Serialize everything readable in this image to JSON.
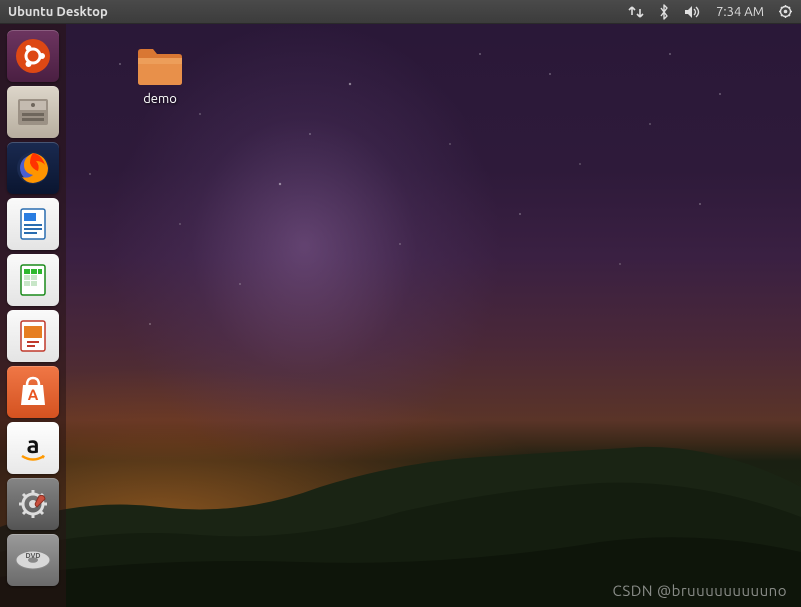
{
  "topbar": {
    "title": "Ubuntu Desktop",
    "time": "7:34 AM",
    "indicators": {
      "network": "network-icon",
      "bluetooth": "bluetooth-icon",
      "sound": "volume-icon",
      "power": "power-cog-icon"
    }
  },
  "launcher": {
    "items": [
      {
        "name": "dash-home",
        "label": "Dash",
        "bg": "#5e2750"
      },
      {
        "name": "files",
        "label": "Files",
        "bg": "#cfc8bd"
      },
      {
        "name": "firefox",
        "label": "Firefox",
        "bg": "#0a1733"
      },
      {
        "name": "writer",
        "label": "LibreOffice Writer",
        "bg": "#f6f6f6"
      },
      {
        "name": "calc",
        "label": "LibreOffice Calc",
        "bg": "#f6f6f6"
      },
      {
        "name": "impress",
        "label": "LibreOffice Impress",
        "bg": "#f6f6f6"
      },
      {
        "name": "software",
        "label": "Ubuntu Software",
        "bg": "#e95420"
      },
      {
        "name": "amazon",
        "label": "Amazon",
        "bg": "#ffffff"
      },
      {
        "name": "settings",
        "label": "System Settings",
        "bg": "#6a6a6a"
      },
      {
        "name": "disc",
        "label": "Disc",
        "bg": "#888888"
      }
    ]
  },
  "desktop": {
    "icons": [
      {
        "name": "demo-folder",
        "label": "demo"
      }
    ]
  },
  "watermark": "CSDN @bruuuuuuuuuno"
}
